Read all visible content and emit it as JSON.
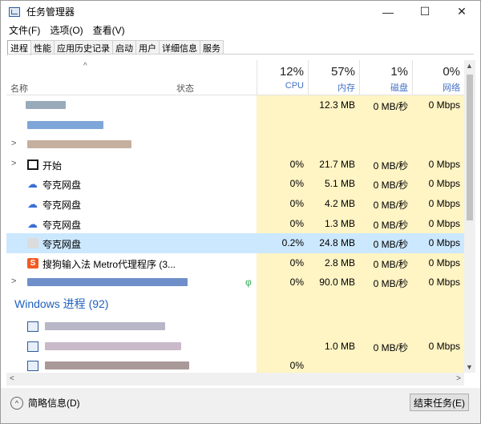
{
  "window": {
    "title": "任务管理器",
    "controls": {
      "minimize": "—",
      "maximize": "☐",
      "close": "✕"
    }
  },
  "menu": [
    "文件(F)",
    "选项(O)",
    "查看(V)"
  ],
  "tabs": [
    "进程",
    "性能",
    "应用历史记录",
    "启动",
    "用户",
    "详细信息",
    "服务"
  ],
  "active_tab": "进程",
  "header": {
    "sort_indicator": "^",
    "name": "名称",
    "status": "状态",
    "cpu": {
      "pct": "12%",
      "label": "CPU"
    },
    "mem": {
      "pct": "57%",
      "label": "内存"
    },
    "disk": {
      "pct": "1%",
      "label": "磁盘"
    },
    "net": {
      "pct": "0%",
      "label": "网络"
    }
  },
  "rows": [
    {
      "name": "",
      "cpu": "",
      "mem": "12.3 MB",
      "disk": "0 MB/秒",
      "net": "0 Mbps",
      "icon": "blurred",
      "redacted": true
    },
    {
      "name": "",
      "cpu": "",
      "mem": "",
      "disk": "",
      "net": "",
      "icon": "blurred",
      "redacted": true
    },
    {
      "name": "",
      "cpu": "",
      "mem": "",
      "disk": "",
      "net": "",
      "icon": "blurred",
      "redacted": true,
      "expandable": true
    },
    {
      "name": "开始",
      "cpu": "0%",
      "mem": "21.7 MB",
      "disk": "0 MB/秒",
      "net": "0 Mbps",
      "icon": "start-icon",
      "expandable": true
    },
    {
      "name": "夸克网盘",
      "cpu": "0%",
      "mem": "5.1 MB",
      "disk": "0 MB/秒",
      "net": "0 Mbps",
      "icon": "cloud-icon"
    },
    {
      "name": "夸克网盘",
      "cpu": "0%",
      "mem": "4.2 MB",
      "disk": "0 MB/秒",
      "net": "0 Mbps",
      "icon": "cloud-icon"
    },
    {
      "name": "夸克网盘",
      "cpu": "0%",
      "mem": "1.3 MB",
      "disk": "0 MB/秒",
      "net": "0 Mbps",
      "icon": "cloud-icon"
    },
    {
      "name": "夸克网盘",
      "cpu": "0.2%",
      "mem": "24.8 MB",
      "disk": "0 MB/秒",
      "net": "0 Mbps",
      "icon": "blank-icon",
      "selected": true
    },
    {
      "name": "搜狗输入法 Metro代理程序 (3...",
      "cpu": "0%",
      "mem": "2.8 MB",
      "disk": "0 MB/秒",
      "net": "0 Mbps",
      "icon": "sogou-icon"
    },
    {
      "name": "",
      "cpu": "0%",
      "mem": "90.0 MB",
      "disk": "0 MB/秒",
      "net": "0 Mbps",
      "icon": "blurred",
      "redacted": true,
      "expandable": true,
      "status_leaf": "φ"
    }
  ],
  "group": {
    "label": "Windows 进程 (92)"
  },
  "group_rows": [
    {
      "name": "",
      "cpu": "",
      "mem": "",
      "disk": "",
      "net": "",
      "icon": "proc-icon",
      "redacted": true
    },
    {
      "name": "",
      "cpu": "",
      "mem": "1.0 MB",
      "disk": "0 MB/秒",
      "net": "0 Mbps",
      "icon": "proc-icon",
      "redacted": true
    },
    {
      "name": "",
      "cpu": "0%",
      "mem": "",
      "disk": "",
      "net": "",
      "icon": "proc-icon",
      "redacted": true
    }
  ],
  "footer": {
    "fewer_details": "简略信息(D)",
    "fewer_icon": "chevron-up-circle-icon",
    "end_task": "结束任务(E)"
  },
  "colors": {
    "usage_cell": "#fff4c4",
    "selected_row": "#cce8ff",
    "header_label": "#4472c4",
    "group_label": "#1f5fbf"
  }
}
